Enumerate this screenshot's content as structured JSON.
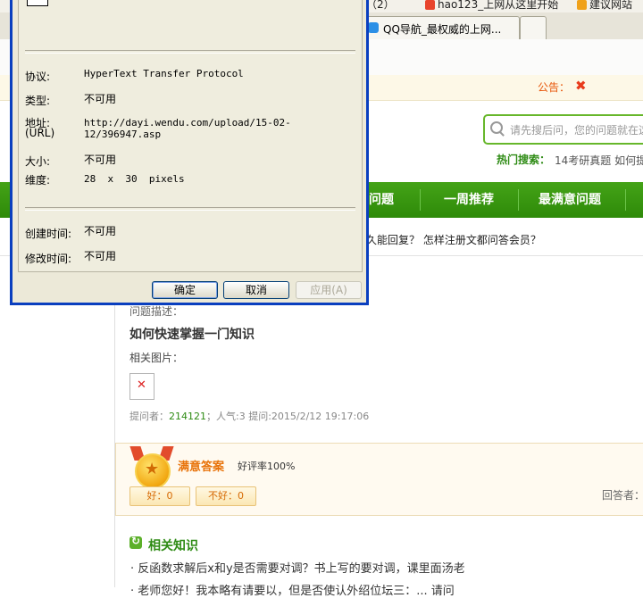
{
  "browser": {
    "favorites": [
      {
        "label": "（2）",
        "icon": "folder-icon"
      },
      {
        "label": "hao123_上网从这里开始",
        "icon": "hao123-icon"
      },
      {
        "label": "建议网站",
        "icon": "suggested-sites-icon"
      }
    ],
    "tabs": [
      {
        "label": "QQ导航_最权威的上网..."
      }
    ]
  },
  "header": {
    "notice_label": "公告：",
    "notice_close": "✖",
    "search_placeholder": "请先搜后问，您的问题就在这",
    "hot_label": "热门搜索：",
    "hot_words": "14考研真题  如何提"
  },
  "nav": {
    "items": [
      "问题",
      "一周推荐",
      "最满意问题"
    ]
  },
  "faq_line": "久能回复？  怎样注册文都问答会员？",
  "question": {
    "desc_label": "问题描述：",
    "title": "如何快速掌握一门知识",
    "images_label": "相关图片：",
    "asker_prefix": "提问者：",
    "asker_id": "214121",
    "meta_rest": "；人气:3  提问:2015/2/12 19:17:06"
  },
  "answer": {
    "label": "满意答案",
    "rating": "好评率100%",
    "good_btn": "好：0",
    "bad_btn": "不好：0",
    "answerer_label": "回答者："
  },
  "related": {
    "title": "相关知识",
    "items": [
      "· 反函数求解后x和y是否需要对调？书上写的要对调，课里面汤老",
      "· 老师您好！我本略有请要以，但是否使认外绍位坛三：... 请问"
    ]
  },
  "dialog": {
    "fields": [
      {
        "label": "协议:",
        "value": "HyperText Transfer Protocol"
      },
      {
        "label": "类型:",
        "value": "不可用"
      },
      {
        "label": "地址:",
        "label2": "(URL)",
        "value": "http://dayi.wendu.com/upload/15-02-",
        "value2": "12/396947.asp"
      },
      {
        "label": "大小:",
        "value": "不可用"
      },
      {
        "label": "维度:",
        "value": "28  x  30  pixels"
      },
      {
        "label": "创建时间:",
        "value": "不可用"
      },
      {
        "label": "修改时间:",
        "value": "不可用"
      }
    ],
    "ok_label": "确定",
    "cancel_label": "取消",
    "apply_label": "应用(A)"
  }
}
